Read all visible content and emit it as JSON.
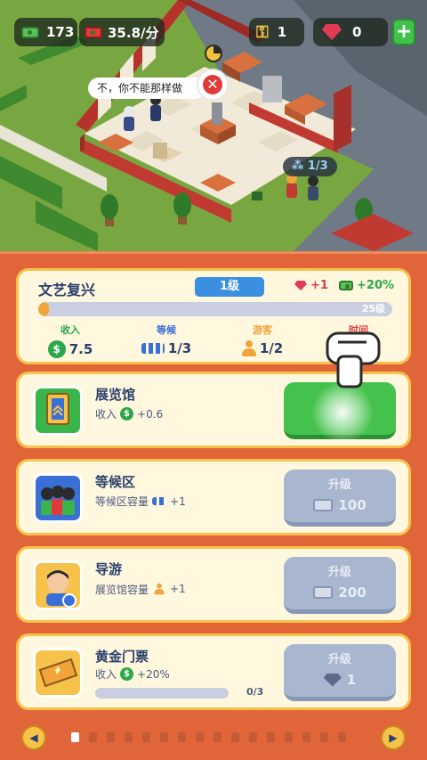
{
  "hud": {
    "money": "173",
    "income_rate": "35.8/分",
    "keys": "1",
    "gems": "0",
    "add_label": "+"
  },
  "scene": {
    "speech": "不，你不能那样做",
    "deny_symbol": "✕",
    "queue_tag": "1/3"
  },
  "museum": {
    "name": "文艺复兴",
    "level": "1级",
    "bonus_gem": "+1",
    "bonus_cash": "+20%",
    "progress": 0.03,
    "max_level": "25级",
    "stats": [
      {
        "label": "收入",
        "value": "7.5",
        "color": "#2aa84a"
      },
      {
        "label": "等候",
        "value": "1/3",
        "color": "#3a6fd8"
      },
      {
        "label": "游客",
        "value": "1/2",
        "color": "#f1a43a"
      },
      {
        "label": "时间",
        "value": "",
        "color": "#e23a3a"
      }
    ],
    "income_coin": "$"
  },
  "upgrades": [
    {
      "title": "展览馆",
      "desc_prefix": "收入",
      "desc_value": "+0.6",
      "button": "",
      "cost": ""
    },
    {
      "title": "等候区",
      "desc_prefix": "等候区容量",
      "desc_value": "+1",
      "button": "升级",
      "cost": "100"
    },
    {
      "title": "导游",
      "desc_prefix": "展览馆容量",
      "desc_value": "+1",
      "button": "升级",
      "cost": "200"
    },
    {
      "title": "黄金门票",
      "desc_prefix": "收入",
      "desc_value": "+20%",
      "button": "升级",
      "cost": "1",
      "progress_text": "0/3"
    }
  ],
  "nav": {
    "prev": "◀",
    "next": "▶",
    "page_count": 16,
    "active_page": 0
  }
}
